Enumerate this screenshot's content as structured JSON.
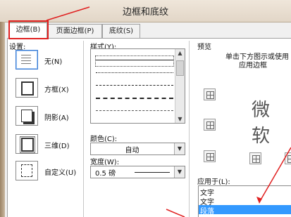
{
  "window": {
    "title": "边框和底纹"
  },
  "tabs": [
    {
      "label": "边框(B)"
    },
    {
      "label": "页面边框(P)"
    },
    {
      "label": "底纹(S)"
    }
  ],
  "settings": {
    "heading": "设置:",
    "items": [
      {
        "label": "无(N)"
      },
      {
        "label": "方框(X)"
      },
      {
        "label": "阴影(A)"
      },
      {
        "label": "三维(D)"
      },
      {
        "label": "自定义(U)"
      }
    ]
  },
  "style": {
    "heading": "样式(Y):",
    "selected_index": 0
  },
  "color": {
    "heading": "颜色(C):",
    "value": "自动"
  },
  "width": {
    "heading": "宽度(W):",
    "value": "0.5 磅"
  },
  "preview": {
    "heading": "预览",
    "hint_line1": "单击下方图示或使用",
    "hint_line2": "应用边框",
    "sample_text": "微软"
  },
  "apply_to": {
    "heading": "应用于(L):",
    "value": "文字",
    "options": [
      "文字",
      "段落"
    ],
    "highlighted": "段落"
  },
  "colors": {
    "annotation": "#e02020",
    "highlight": "#3399ff",
    "titlebar": "#e8dfd2"
  }
}
